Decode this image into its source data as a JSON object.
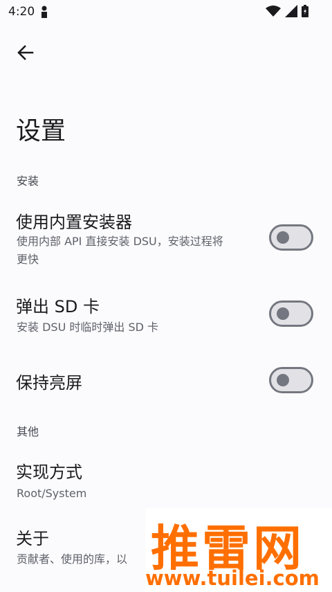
{
  "status_bar": {
    "time": "4:20",
    "icons": [
      "person-icon",
      "wifi-icon",
      "signal-icon",
      "battery-icon"
    ]
  },
  "toolbar": {
    "back_icon": "arrow-back-icon"
  },
  "page": {
    "title": "设置"
  },
  "sections": {
    "install": {
      "header": "安装",
      "internal_installer": {
        "title": "使用内置安装器",
        "subtitle_line1": "使用内部 API 直接安装 DSU，安装过程将",
        "subtitle_line2": "更快",
        "enabled": false
      },
      "eject_sd": {
        "title": "弹出 SD 卡",
        "subtitle": "安装 DSU 时临时弹出 SD 卡",
        "enabled": false
      },
      "keep_screen_on": {
        "title": "保持亮屏",
        "enabled": false
      }
    },
    "other": {
      "header": "其他",
      "implementation": {
        "title": "实现方式",
        "subtitle": "Root/System"
      },
      "about": {
        "title": "关于",
        "subtitle": "贡献者、使用的库，以"
      }
    }
  },
  "watermark": {
    "big": "推雷网",
    "small": "www.tuilei.com"
  },
  "colors": {
    "background": "#fbfbfe",
    "switch_outline": "#74777f",
    "switch_track": "#e2e2e6",
    "watermark": "#ff6f00"
  }
}
